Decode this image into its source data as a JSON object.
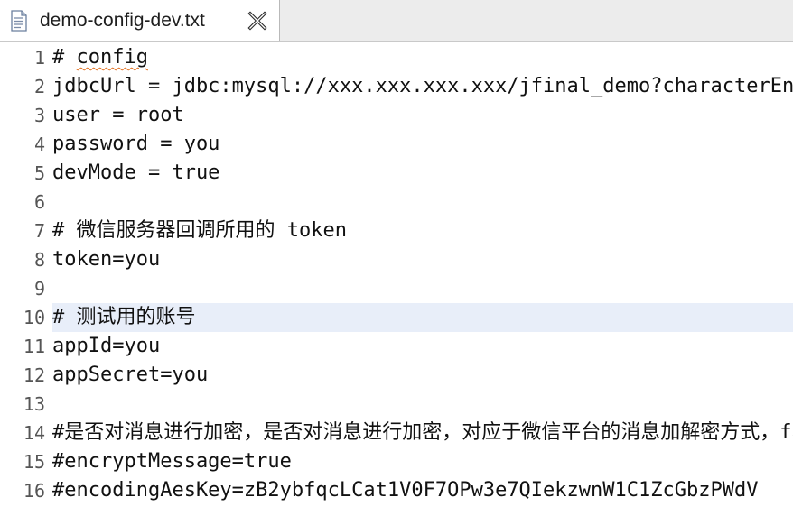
{
  "tab": {
    "title": "demo-config-dev.txt",
    "icon": "text-file-icon",
    "close_icon": "close-icon"
  },
  "editor": {
    "lines": [
      {
        "num": "1",
        "prefix": "# ",
        "text": "config",
        "highlighted": false
      },
      {
        "num": "2",
        "prefix": "",
        "text": "jdbcUrl = jdbc:mysql://xxx.xxx.xxx.xxx/jfinal_demo?characterEn",
        "highlighted": false
      },
      {
        "num": "3",
        "prefix": "",
        "text": "user = root",
        "highlighted": false
      },
      {
        "num": "4",
        "prefix": "",
        "text": "password = you",
        "highlighted": false
      },
      {
        "num": "5",
        "prefix": "",
        "text": "devMode = true",
        "highlighted": false
      },
      {
        "num": "6",
        "prefix": "",
        "text": "",
        "highlighted": false
      },
      {
        "num": "7",
        "prefix": "",
        "text": "# 微信服务器回调所用的 token",
        "highlighted": false
      },
      {
        "num": "8",
        "prefix": "",
        "text": "token=you",
        "highlighted": false
      },
      {
        "num": "9",
        "prefix": "",
        "text": "",
        "highlighted": false
      },
      {
        "num": "10",
        "prefix": "",
        "text": "# 测试用的账号",
        "highlighted": true
      },
      {
        "num": "11",
        "prefix": "",
        "text": "appId=you",
        "highlighted": false
      },
      {
        "num": "12",
        "prefix": "",
        "text": "appSecret=you",
        "highlighted": false
      },
      {
        "num": "13",
        "prefix": "",
        "text": "",
        "highlighted": false
      },
      {
        "num": "14",
        "prefix": "",
        "text": "#是否对消息进行加密，是否对消息进行加密，对应于微信平台的消息加解密方式，fa",
        "highlighted": false
      },
      {
        "num": "15",
        "prefix": "",
        "text": "#encryptMessage=true",
        "highlighted": false
      },
      {
        "num": "16",
        "prefix": "",
        "text": "#encodingAesKey=zB2ybfqcLCat1V0F7OPw3e7QIekzwnW1C1ZcGbzPWdV",
        "highlighted": false
      }
    ]
  },
  "colors": {
    "highlight": "#e8eef9",
    "spell_underline": "#e2701f",
    "tab_bar": "#ececec"
  }
}
